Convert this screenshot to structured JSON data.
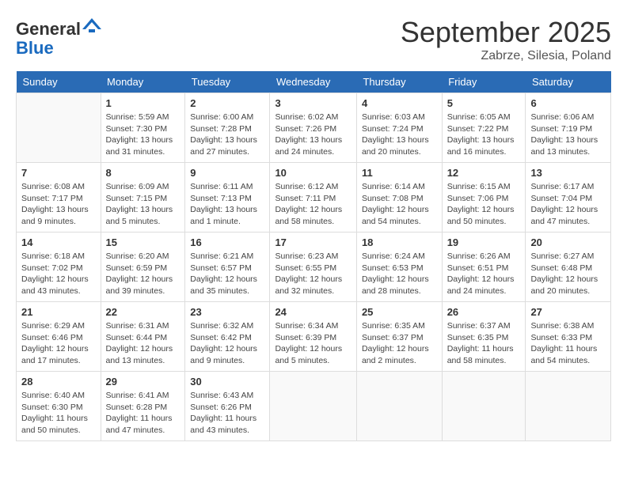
{
  "header": {
    "logo_line1": "General",
    "logo_line2": "Blue",
    "month": "September 2025",
    "location": "Zabrze, Silesia, Poland"
  },
  "weekdays": [
    "Sunday",
    "Monday",
    "Tuesday",
    "Wednesday",
    "Thursday",
    "Friday",
    "Saturday"
  ],
  "weeks": [
    [
      {
        "day": "",
        "info": ""
      },
      {
        "day": "1",
        "info": "Sunrise: 5:59 AM\nSunset: 7:30 PM\nDaylight: 13 hours\nand 31 minutes."
      },
      {
        "day": "2",
        "info": "Sunrise: 6:00 AM\nSunset: 7:28 PM\nDaylight: 13 hours\nand 27 minutes."
      },
      {
        "day": "3",
        "info": "Sunrise: 6:02 AM\nSunset: 7:26 PM\nDaylight: 13 hours\nand 24 minutes."
      },
      {
        "day": "4",
        "info": "Sunrise: 6:03 AM\nSunset: 7:24 PM\nDaylight: 13 hours\nand 20 minutes."
      },
      {
        "day": "5",
        "info": "Sunrise: 6:05 AM\nSunset: 7:22 PM\nDaylight: 13 hours\nand 16 minutes."
      },
      {
        "day": "6",
        "info": "Sunrise: 6:06 AM\nSunset: 7:19 PM\nDaylight: 13 hours\nand 13 minutes."
      }
    ],
    [
      {
        "day": "7",
        "info": "Sunrise: 6:08 AM\nSunset: 7:17 PM\nDaylight: 13 hours\nand 9 minutes."
      },
      {
        "day": "8",
        "info": "Sunrise: 6:09 AM\nSunset: 7:15 PM\nDaylight: 13 hours\nand 5 minutes."
      },
      {
        "day": "9",
        "info": "Sunrise: 6:11 AM\nSunset: 7:13 PM\nDaylight: 13 hours\nand 1 minute."
      },
      {
        "day": "10",
        "info": "Sunrise: 6:12 AM\nSunset: 7:11 PM\nDaylight: 12 hours\nand 58 minutes."
      },
      {
        "day": "11",
        "info": "Sunrise: 6:14 AM\nSunset: 7:08 PM\nDaylight: 12 hours\nand 54 minutes."
      },
      {
        "day": "12",
        "info": "Sunrise: 6:15 AM\nSunset: 7:06 PM\nDaylight: 12 hours\nand 50 minutes."
      },
      {
        "day": "13",
        "info": "Sunrise: 6:17 AM\nSunset: 7:04 PM\nDaylight: 12 hours\nand 47 minutes."
      }
    ],
    [
      {
        "day": "14",
        "info": "Sunrise: 6:18 AM\nSunset: 7:02 PM\nDaylight: 12 hours\nand 43 minutes."
      },
      {
        "day": "15",
        "info": "Sunrise: 6:20 AM\nSunset: 6:59 PM\nDaylight: 12 hours\nand 39 minutes."
      },
      {
        "day": "16",
        "info": "Sunrise: 6:21 AM\nSunset: 6:57 PM\nDaylight: 12 hours\nand 35 minutes."
      },
      {
        "day": "17",
        "info": "Sunrise: 6:23 AM\nSunset: 6:55 PM\nDaylight: 12 hours\nand 32 minutes."
      },
      {
        "day": "18",
        "info": "Sunrise: 6:24 AM\nSunset: 6:53 PM\nDaylight: 12 hours\nand 28 minutes."
      },
      {
        "day": "19",
        "info": "Sunrise: 6:26 AM\nSunset: 6:51 PM\nDaylight: 12 hours\nand 24 minutes."
      },
      {
        "day": "20",
        "info": "Sunrise: 6:27 AM\nSunset: 6:48 PM\nDaylight: 12 hours\nand 20 minutes."
      }
    ],
    [
      {
        "day": "21",
        "info": "Sunrise: 6:29 AM\nSunset: 6:46 PM\nDaylight: 12 hours\nand 17 minutes."
      },
      {
        "day": "22",
        "info": "Sunrise: 6:31 AM\nSunset: 6:44 PM\nDaylight: 12 hours\nand 13 minutes."
      },
      {
        "day": "23",
        "info": "Sunrise: 6:32 AM\nSunset: 6:42 PM\nDaylight: 12 hours\nand 9 minutes."
      },
      {
        "day": "24",
        "info": "Sunrise: 6:34 AM\nSunset: 6:39 PM\nDaylight: 12 hours\nand 5 minutes."
      },
      {
        "day": "25",
        "info": "Sunrise: 6:35 AM\nSunset: 6:37 PM\nDaylight: 12 hours\nand 2 minutes."
      },
      {
        "day": "26",
        "info": "Sunrise: 6:37 AM\nSunset: 6:35 PM\nDaylight: 11 hours\nand 58 minutes."
      },
      {
        "day": "27",
        "info": "Sunrise: 6:38 AM\nSunset: 6:33 PM\nDaylight: 11 hours\nand 54 minutes."
      }
    ],
    [
      {
        "day": "28",
        "info": "Sunrise: 6:40 AM\nSunset: 6:30 PM\nDaylight: 11 hours\nand 50 minutes."
      },
      {
        "day": "29",
        "info": "Sunrise: 6:41 AM\nSunset: 6:28 PM\nDaylight: 11 hours\nand 47 minutes."
      },
      {
        "day": "30",
        "info": "Sunrise: 6:43 AM\nSunset: 6:26 PM\nDaylight: 11 hours\nand 43 minutes."
      },
      {
        "day": "",
        "info": ""
      },
      {
        "day": "",
        "info": ""
      },
      {
        "day": "",
        "info": ""
      },
      {
        "day": "",
        "info": ""
      }
    ]
  ]
}
